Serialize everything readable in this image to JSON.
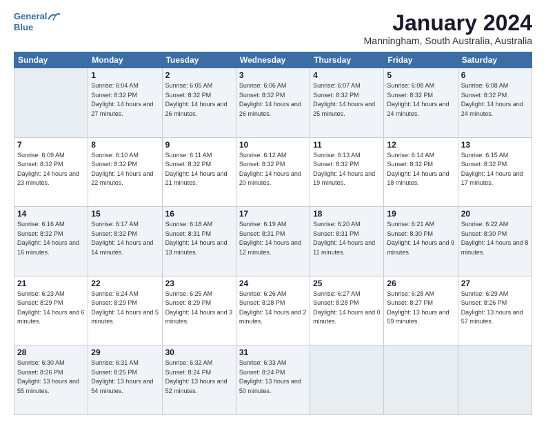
{
  "logo": {
    "line1": "General",
    "line2": "Blue"
  },
  "title": "January 2024",
  "subtitle": "Manningham, South Australia, Australia",
  "days_of_week": [
    "Sunday",
    "Monday",
    "Tuesday",
    "Wednesday",
    "Thursday",
    "Friday",
    "Saturday"
  ],
  "weeks": [
    [
      {
        "day": "",
        "empty": true
      },
      {
        "day": "1",
        "sunrise": "6:04 AM",
        "sunset": "8:32 PM",
        "daylight": "14 hours and 27 minutes."
      },
      {
        "day": "2",
        "sunrise": "6:05 AM",
        "sunset": "8:32 PM",
        "daylight": "14 hours and 26 minutes."
      },
      {
        "day": "3",
        "sunrise": "6:06 AM",
        "sunset": "8:32 PM",
        "daylight": "14 hours and 26 minutes."
      },
      {
        "day": "4",
        "sunrise": "6:07 AM",
        "sunset": "8:32 PM",
        "daylight": "14 hours and 25 minutes."
      },
      {
        "day": "5",
        "sunrise": "6:08 AM",
        "sunset": "8:32 PM",
        "daylight": "14 hours and 24 minutes."
      },
      {
        "day": "6",
        "sunrise": "6:08 AM",
        "sunset": "8:32 PM",
        "daylight": "14 hours and 24 minutes."
      }
    ],
    [
      {
        "day": "7",
        "sunrise": "6:09 AM",
        "sunset": "8:32 PM",
        "daylight": "14 hours and 23 minutes."
      },
      {
        "day": "8",
        "sunrise": "6:10 AM",
        "sunset": "8:32 PM",
        "daylight": "14 hours and 22 minutes."
      },
      {
        "day": "9",
        "sunrise": "6:11 AM",
        "sunset": "8:32 PM",
        "daylight": "14 hours and 21 minutes."
      },
      {
        "day": "10",
        "sunrise": "6:12 AM",
        "sunset": "8:32 PM",
        "daylight": "14 hours and 20 minutes."
      },
      {
        "day": "11",
        "sunrise": "6:13 AM",
        "sunset": "8:32 PM",
        "daylight": "14 hours and 19 minutes."
      },
      {
        "day": "12",
        "sunrise": "6:14 AM",
        "sunset": "8:32 PM",
        "daylight": "14 hours and 18 minutes."
      },
      {
        "day": "13",
        "sunrise": "6:15 AM",
        "sunset": "8:32 PM",
        "daylight": "14 hours and 17 minutes."
      }
    ],
    [
      {
        "day": "14",
        "sunrise": "6:16 AM",
        "sunset": "8:32 PM",
        "daylight": "14 hours and 16 minutes."
      },
      {
        "day": "15",
        "sunrise": "6:17 AM",
        "sunset": "8:32 PM",
        "daylight": "14 hours and 14 minutes."
      },
      {
        "day": "16",
        "sunrise": "6:18 AM",
        "sunset": "8:31 PM",
        "daylight": "14 hours and 13 minutes."
      },
      {
        "day": "17",
        "sunrise": "6:19 AM",
        "sunset": "8:31 PM",
        "daylight": "14 hours and 12 minutes."
      },
      {
        "day": "18",
        "sunrise": "6:20 AM",
        "sunset": "8:31 PM",
        "daylight": "14 hours and 11 minutes."
      },
      {
        "day": "19",
        "sunrise": "6:21 AM",
        "sunset": "8:30 PM",
        "daylight": "14 hours and 9 minutes."
      },
      {
        "day": "20",
        "sunrise": "6:22 AM",
        "sunset": "8:30 PM",
        "daylight": "14 hours and 8 minutes."
      }
    ],
    [
      {
        "day": "21",
        "sunrise": "6:23 AM",
        "sunset": "8:29 PM",
        "daylight": "14 hours and 6 minutes."
      },
      {
        "day": "22",
        "sunrise": "6:24 AM",
        "sunset": "8:29 PM",
        "daylight": "14 hours and 5 minutes."
      },
      {
        "day": "23",
        "sunrise": "6:25 AM",
        "sunset": "8:29 PM",
        "daylight": "14 hours and 3 minutes."
      },
      {
        "day": "24",
        "sunrise": "6:26 AM",
        "sunset": "8:28 PM",
        "daylight": "14 hours and 2 minutes."
      },
      {
        "day": "25",
        "sunrise": "6:27 AM",
        "sunset": "8:28 PM",
        "daylight": "14 hours and 0 minutes."
      },
      {
        "day": "26",
        "sunrise": "6:28 AM",
        "sunset": "8:27 PM",
        "daylight": "13 hours and 59 minutes."
      },
      {
        "day": "27",
        "sunrise": "6:29 AM",
        "sunset": "8:26 PM",
        "daylight": "13 hours and 57 minutes."
      }
    ],
    [
      {
        "day": "28",
        "sunrise": "6:30 AM",
        "sunset": "8:26 PM",
        "daylight": "13 hours and 55 minutes."
      },
      {
        "day": "29",
        "sunrise": "6:31 AM",
        "sunset": "8:25 PM",
        "daylight": "13 hours and 54 minutes."
      },
      {
        "day": "30",
        "sunrise": "6:32 AM",
        "sunset": "8:24 PM",
        "daylight": "13 hours and 52 minutes."
      },
      {
        "day": "31",
        "sunrise": "6:33 AM",
        "sunset": "8:24 PM",
        "daylight": "13 hours and 50 minutes."
      },
      {
        "day": "",
        "empty": true
      },
      {
        "day": "",
        "empty": true
      },
      {
        "day": "",
        "empty": true
      }
    ]
  ]
}
